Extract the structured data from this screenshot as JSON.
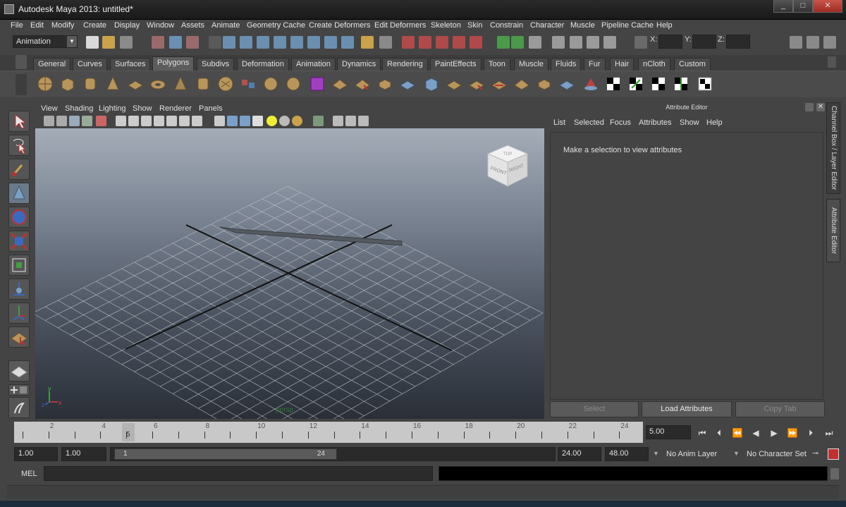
{
  "window": {
    "title": "Autodesk Maya 2013: untitled*",
    "controls": [
      "_",
      "□",
      "✕"
    ]
  },
  "menubar": [
    "File",
    "Edit",
    "Modify",
    "Create",
    "Display",
    "Window",
    "Assets",
    "Animate",
    "Geometry Cache",
    "Create Deformers",
    "Edit Deformers",
    "Skeleton",
    "Skin",
    "Constrain",
    "Character",
    "Muscle",
    "Pipeline Cache",
    "Help"
  ],
  "statusline": {
    "mode": "Animation",
    "x_label": "X:",
    "y_label": "Y:",
    "z_label": "Z:"
  },
  "shelf": {
    "tabs": [
      "General",
      "Curves",
      "Surfaces",
      "Polygons",
      "Subdivs",
      "Deformation",
      "Animation",
      "Dynamics",
      "Rendering",
      "PaintEffects",
      "Toon",
      "Muscle",
      "Fluids",
      "Fur",
      "Hair",
      "nCloth",
      "Custom"
    ],
    "active_tab": "Polygons"
  },
  "viewport": {
    "menu": [
      "View",
      "Shading",
      "Lighting",
      "Show",
      "Renderer",
      "Panels"
    ],
    "camera_label": "persp",
    "viewcube": {
      "front": "FRONT",
      "right": "RIGHT",
      "top": "TOP"
    },
    "axis": {
      "y": "y",
      "x": "x",
      "z": "z"
    }
  },
  "attribute_editor": {
    "title": "Attribute Editor",
    "menu": [
      "List",
      "Selected",
      "Focus",
      "Attributes",
      "Show",
      "Help"
    ],
    "message": "Make a selection to view attributes",
    "buttons": {
      "select": "Select",
      "load": "Load Attributes",
      "copy": "Copy Tab"
    }
  },
  "side_tabs": {
    "channel_box": "Channel Box / Layer Editor",
    "attribute_editor": "Attribute Editor"
  },
  "timeline": {
    "tick_labels": [
      "2",
      "4",
      "6",
      "8",
      "10",
      "12",
      "14",
      "16",
      "18",
      "20",
      "22",
      "24"
    ],
    "current_frame_marker": "5",
    "current_time": "5.00"
  },
  "range": {
    "start_time": "1.00",
    "playback_start": "1.00",
    "range_start_label": "1",
    "range_end_label": "24",
    "playback_end": "24.00",
    "end_time": "48.00",
    "anim_layer": "No Anim Layer",
    "character_set": "No Character Set"
  },
  "command": {
    "language": "MEL"
  }
}
